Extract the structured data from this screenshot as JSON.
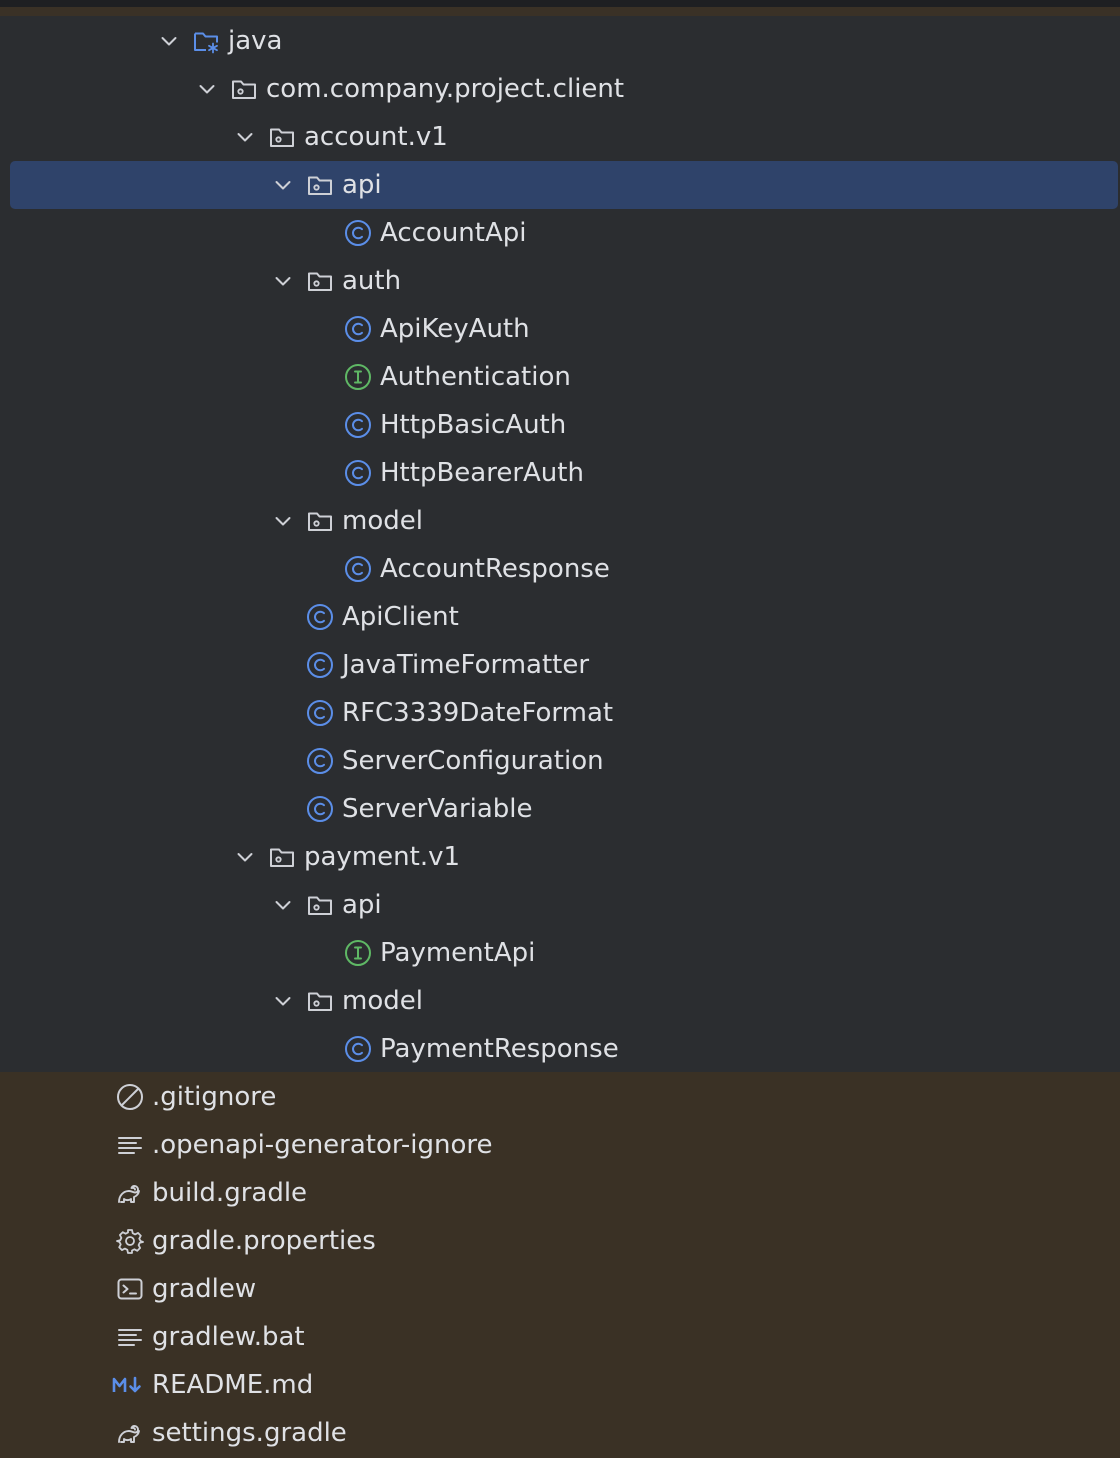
{
  "tree": {
    "rows": [
      {
        "label": "java",
        "icon": "source-folder-icon",
        "expanded": true
      },
      {
        "label": "com.company.project.client",
        "icon": "package-icon",
        "expanded": true
      },
      {
        "label": "account.v1",
        "icon": "package-icon",
        "expanded": true
      },
      {
        "label": "api",
        "icon": "package-icon",
        "expanded": true,
        "selected": true
      },
      {
        "label": "AccountApi",
        "icon": "class-icon"
      },
      {
        "label": "auth",
        "icon": "package-icon",
        "expanded": true
      },
      {
        "label": "ApiKeyAuth",
        "icon": "class-icon"
      },
      {
        "label": "Authentication",
        "icon": "interface-icon"
      },
      {
        "label": "HttpBasicAuth",
        "icon": "class-icon"
      },
      {
        "label": "HttpBearerAuth",
        "icon": "class-icon"
      },
      {
        "label": "model",
        "icon": "package-icon",
        "expanded": true
      },
      {
        "label": "AccountResponse",
        "icon": "class-icon"
      },
      {
        "label": "ApiClient",
        "icon": "class-icon"
      },
      {
        "label": "JavaTimeFormatter",
        "icon": "class-icon"
      },
      {
        "label": "RFC3339DateFormat",
        "icon": "class-icon"
      },
      {
        "label": "ServerConfiguration",
        "icon": "class-icon"
      },
      {
        "label": "ServerVariable",
        "icon": "class-icon"
      },
      {
        "label": "payment.v1",
        "icon": "package-icon",
        "expanded": true
      },
      {
        "label": "api",
        "icon": "package-icon",
        "expanded": true
      },
      {
        "label": "PaymentApi",
        "icon": "interface-icon"
      },
      {
        "label": "model",
        "icon": "package-icon",
        "expanded": true
      },
      {
        "label": "PaymentResponse",
        "icon": "class-icon"
      },
      {
        "label": ".gitignore",
        "icon": "ignore-file-icon"
      },
      {
        "label": ".openapi-generator-ignore",
        "icon": "text-file-icon"
      },
      {
        "label": "build.gradle",
        "icon": "gradle-icon"
      },
      {
        "label": "gradle.properties",
        "icon": "settings-gear-icon"
      },
      {
        "label": "gradlew",
        "icon": "terminal-icon"
      },
      {
        "label": "gradlew.bat",
        "icon": "text-file-icon"
      },
      {
        "label": "README.md",
        "icon": "markdown-icon"
      },
      {
        "label": "settings.gradle",
        "icon": "gradle-icon"
      }
    ]
  },
  "colors": {
    "background": "#2b2d30",
    "files_background": "#3a3125",
    "selection": "#2f436a",
    "text": "#dfe1e5",
    "class_icon": "#5b8ee8",
    "interface_icon": "#5fb865",
    "icon_gray": "#ced0d6"
  }
}
